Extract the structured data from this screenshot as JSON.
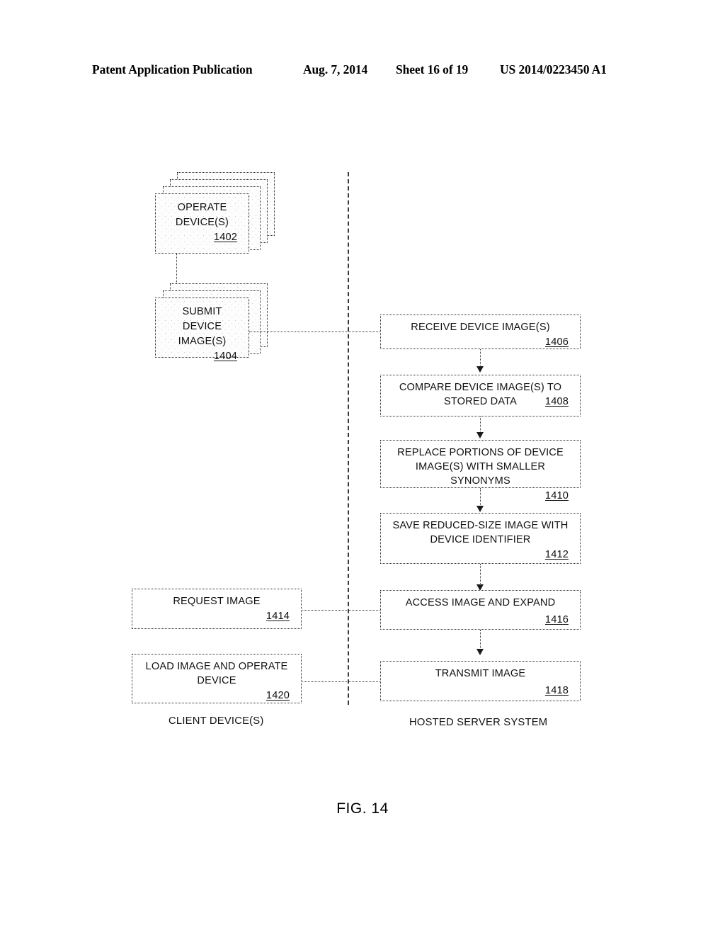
{
  "header": {
    "publication": "Patent Application Publication",
    "date": "Aug. 7, 2014",
    "sheet": "Sheet 16 of 19",
    "patent_number": "US 2014/0223450 A1"
  },
  "figure": {
    "caption": "FIG. 14",
    "lanes": [
      {
        "name": "client",
        "caption": "CLIENT DEVICE(S)"
      },
      {
        "name": "server",
        "caption": "HOSTED SERVER SYSTEM"
      }
    ],
    "blocks": [
      {
        "id": "1402",
        "label": "OPERATE\nDEVICE(S)",
        "number": "1402",
        "lane": "client",
        "style": "stacked"
      },
      {
        "id": "1404",
        "label": "SUBMIT DEVICE\nIMAGE(S)",
        "number": "1404",
        "lane": "client",
        "style": "stacked"
      },
      {
        "id": "1406",
        "label": "RECEIVE DEVICE IMAGE(S)",
        "number": "1406",
        "lane": "server",
        "style": "plain"
      },
      {
        "id": "1408",
        "label": "COMPARE DEVICE IMAGE(S) TO\nSTORED DATA",
        "number": "1408",
        "lane": "server",
        "style": "plain"
      },
      {
        "id": "1410",
        "label": "REPLACE PORTIONS OF DEVICE\nIMAGE(S) WITH SMALLER SYNONYMS",
        "number": "1410",
        "lane": "server",
        "style": "plain"
      },
      {
        "id": "1412",
        "label": "SAVE REDUCED-SIZE IMAGE WITH\nDEVICE IDENTIFIER",
        "number": "1412",
        "lane": "server",
        "style": "plain"
      },
      {
        "id": "1414",
        "label": "REQUEST IMAGE",
        "number": "1414",
        "lane": "client",
        "style": "plain"
      },
      {
        "id": "1416",
        "label": "ACCESS IMAGE AND EXPAND",
        "number": "1416",
        "lane": "server",
        "style": "plain"
      },
      {
        "id": "1420",
        "label": "LOAD IMAGE AND OPERATE\nDEVICE",
        "number": "1420",
        "lane": "client",
        "style": "plain"
      },
      {
        "id": "1418",
        "label": "TRANSMIT IMAGE",
        "number": "1418",
        "lane": "server",
        "style": "plain"
      }
    ],
    "flows": [
      {
        "from": "1402",
        "to": "1404",
        "kind": "line"
      },
      {
        "from": "1404",
        "to": "1406",
        "kind": "line"
      },
      {
        "from": "1406",
        "to": "1408",
        "kind": "arrow"
      },
      {
        "from": "1408",
        "to": "1410",
        "kind": "arrow"
      },
      {
        "from": "1410",
        "to": "1412",
        "kind": "arrow"
      },
      {
        "from": "1412",
        "to": "1416",
        "kind": "arrow"
      },
      {
        "from": "1414",
        "to": "1416",
        "kind": "line"
      },
      {
        "from": "1416",
        "to": "1418",
        "kind": "arrow"
      },
      {
        "from": "1418",
        "to": "1420",
        "kind": "line"
      }
    ]
  },
  "colors": {
    "ink": "#111111",
    "line": "#333333",
    "paper": "#ffffff"
  }
}
